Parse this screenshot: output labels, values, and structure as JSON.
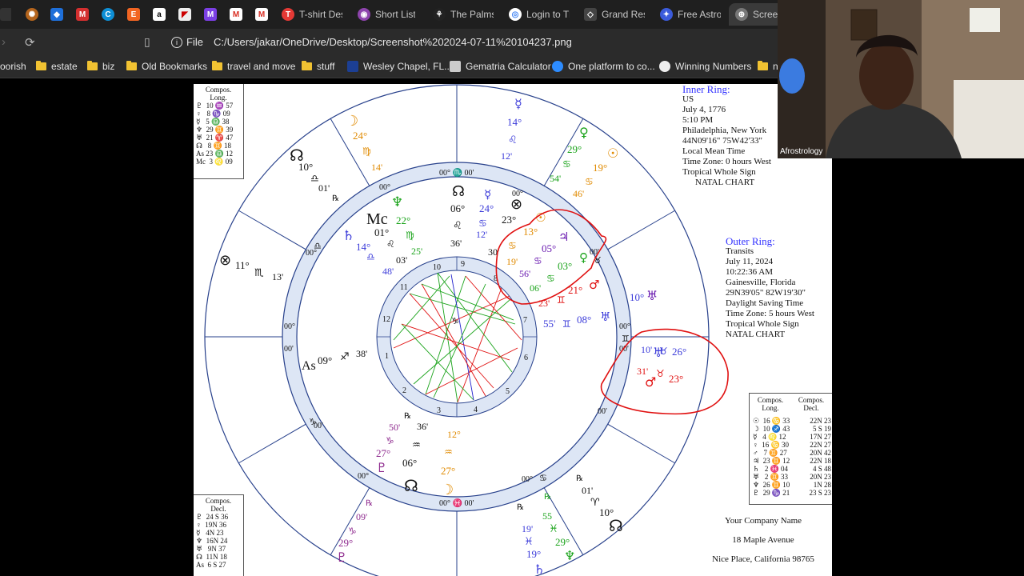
{
  "tabs": [
    {
      "label": "T-shirt Des",
      "icon": "tshirt-icon"
    },
    {
      "label": "Short List |",
      "icon": "shortlist-icon"
    },
    {
      "label": "The Palms",
      "icon": "palms-icon"
    },
    {
      "label": "Login to Th",
      "icon": "chrome-icon"
    },
    {
      "label": "Grand Rese",
      "icon": "grand-icon"
    },
    {
      "label": "Free Astrol",
      "icon": "astro-icon"
    },
    {
      "label": "Screen",
      "icon": "globe-icon"
    }
  ],
  "address": {
    "file_label": "File",
    "url": "C:/Users/jakar/OneDrive/Desktop/Screenshot%202024-07-11%20104237.png"
  },
  "bookmarks": [
    "oorish",
    "estate",
    "biz",
    "Old Bookmarks",
    "travel and move",
    "stuff",
    "Wesley Chapel, FL...",
    "Gematria Calculator",
    "One platform to co...",
    "Winning Numbers",
    "n"
  ],
  "inner_ring": {
    "heading": "Inner Ring:",
    "lines": [
      "US",
      "July 4, 1776",
      "5:10 PM",
      "Philadelphia, New York",
      "44N09'16\"  75W42'33\"",
      "Local Mean Time",
      "Time Zone: 0 hours West",
      "Tropical Whole Sign",
      "NATAL CHART"
    ]
  },
  "outer_ring": {
    "heading": "Outer Ring:",
    "lines": [
      "Transits",
      "July 11, 2024",
      "10:22:36 AM",
      "Gainesville, Florida",
      "29N39'05\"  82W19'30\"",
      "Daylight Saving Time",
      "Time Zone: 5 hours West",
      "Tropical Whole Sign",
      "NATAL CHART"
    ]
  },
  "company": {
    "name": "Your Company Name",
    "street": "18 Maple Avenue",
    "city": "Nice Place, California 98765"
  },
  "compos_long_box": {
    "title": "Compos.\nLong.",
    "rows": [
      "♇  10 ♒ 57",
      "♀   8 ♑ 09",
      "☿   5 ♎ 38",
      "♆  29 ♊ 39",
      "♅  21 ♈ 47",
      "☊   8 ♊ 18",
      "As 23 ♎ 12",
      "Mc  3 ♌ 09"
    ]
  },
  "compos_decl_box": {
    "title": "Compos.\nDecl.",
    "rows": [
      "♇  24 S 36",
      "♀  19N 36",
      "☿   4N 23",
      "♆  16N 24",
      "♅   9N 37",
      "☊  11N 18",
      "As  6 S 27"
    ]
  },
  "right_table": {
    "headers": [
      "Compos.\nLong.",
      "Compos.\nDecl."
    ],
    "rows": [
      [
        "☉  16 ♋ 33",
        "22N 23"
      ],
      [
        "☽  10 ♐ 43",
        " 5 S 19"
      ],
      [
        "☿   4 ♌ 12",
        "17N 27"
      ],
      [
        "♀  16 ♋ 30",
        "22N 27"
      ],
      [
        "♂   7 ♊ 27",
        "20N 42"
      ],
      [
        "♃  23 ♊ 12",
        "22N 18"
      ],
      [
        "♄   2 ♓ 04",
        " 4 S 48"
      ],
      [
        "♅   2 ♊ 33",
        "20N 23"
      ],
      [
        "♆  26 ♊ 10",
        " 1N 28"
      ],
      [
        "♇  29 ♑ 21",
        "23 S 23"
      ]
    ]
  },
  "webcam_label": "Afrostrology",
  "colors": {
    "ring_fill": "#dde6f5",
    "ring_stroke": "#27408b",
    "red_annotation": "#e01010"
  }
}
